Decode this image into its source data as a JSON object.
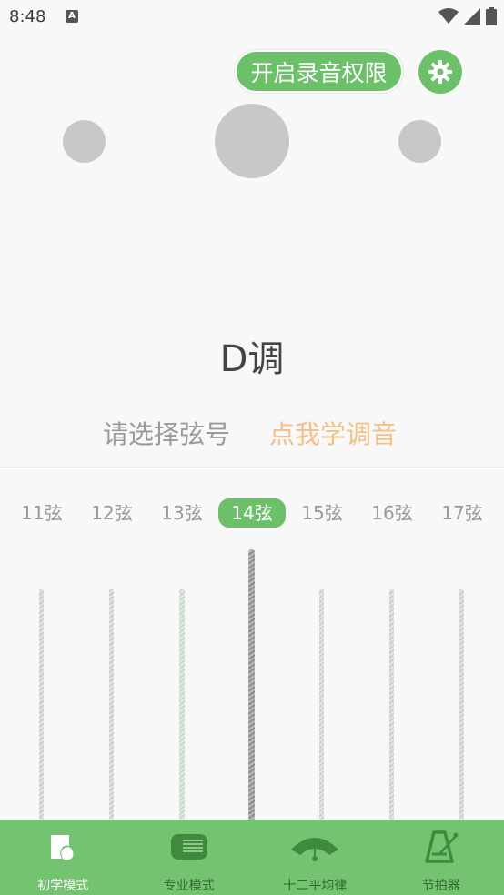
{
  "status_bar": {
    "time": "8:48",
    "notification_glyph": "A",
    "icons": [
      "wifi-icon",
      "signal-icon",
      "battery-icon"
    ]
  },
  "header": {
    "permission_button": "开启录音权限",
    "settings_icon": "gear-icon"
  },
  "tuner": {
    "key_label": "D调",
    "select_prompt": "请选择弦号",
    "learn_link": "点我学调音"
  },
  "strings": {
    "tabs": [
      "11弦",
      "12弦",
      "13弦",
      "14弦",
      "15弦",
      "16弦",
      "17弦"
    ],
    "selected": "14弦"
  },
  "tabbar": {
    "items": [
      {
        "label": "初学模式",
        "icon": "hand-pick-icon"
      },
      {
        "label": "专业模式",
        "icon": "strings-panel-icon"
      },
      {
        "label": "十二平均律",
        "icon": "gauge-icon"
      },
      {
        "label": "节拍器",
        "icon": "metronome-icon"
      }
    ],
    "active": "初学模式"
  },
  "colors": {
    "accent": "#6cc06a",
    "link": "#f3c089",
    "tabbar": "#74c370"
  }
}
